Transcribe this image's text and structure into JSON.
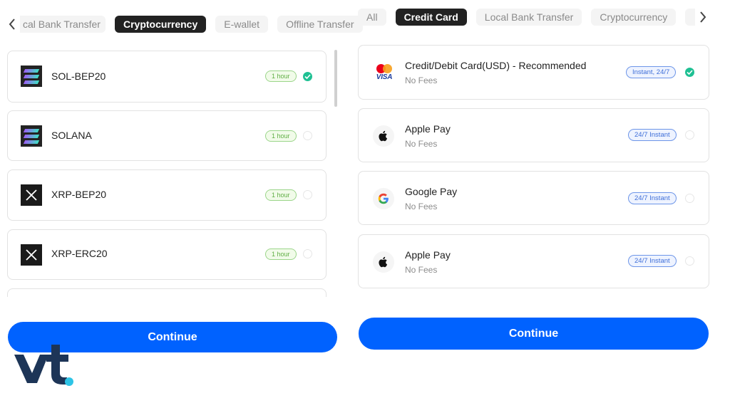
{
  "left": {
    "tabs": [
      {
        "label": "cal Bank Transfer",
        "active": false
      },
      {
        "label": "Cryptocurrency",
        "active": true
      },
      {
        "label": "E-wallet",
        "active": false
      },
      {
        "label": "Offline Transfer",
        "active": false
      }
    ],
    "methods": [
      {
        "name": "SOL-BEP20",
        "badge": "1 hour",
        "selected": true,
        "icon": "solana-icon"
      },
      {
        "name": "SOLANA",
        "badge": "1 hour",
        "selected": false,
        "icon": "solana-icon"
      },
      {
        "name": "XRP-BEP20",
        "badge": "1 hour",
        "selected": false,
        "icon": "xrp-icon"
      },
      {
        "name": "XRP-ERC20",
        "badge": "1 hour",
        "selected": false,
        "icon": "xrp-icon"
      }
    ],
    "continue_label": "Continue"
  },
  "right": {
    "tabs": [
      {
        "label": "All",
        "active": false
      },
      {
        "label": "Credit Card",
        "active": true
      },
      {
        "label": "Local Bank Transfer",
        "active": false
      },
      {
        "label": "Cryptocurrency",
        "active": false
      }
    ],
    "methods": [
      {
        "name": "Credit/Debit Card(USD) - Recommended",
        "fee": "No Fees",
        "badge": "Instant, 24/7",
        "selected": true,
        "icon": "visa-mastercard-icon"
      },
      {
        "name": "Apple Pay",
        "fee": "No Fees",
        "badge": "24/7 Instant",
        "selected": false,
        "icon": "apple-icon"
      },
      {
        "name": "Google Pay",
        "fee": "No Fees",
        "badge": "24/7 Instant",
        "selected": false,
        "icon": "google-icon"
      },
      {
        "name": "Apple Pay",
        "fee": "No Fees",
        "badge": "24/7 Instant",
        "selected": false,
        "icon": "apple-icon"
      }
    ],
    "continue_label": "Continue"
  },
  "colors": {
    "primary": "#0062ff",
    "active_tab": "#222222",
    "check": "#1fc093",
    "badge_green": "#5fae44",
    "badge_blue": "#3f6fd8",
    "watermark_dark": "#1d3557",
    "watermark_accent": "#2ec4e6"
  },
  "watermark": {
    "text": "vt"
  }
}
